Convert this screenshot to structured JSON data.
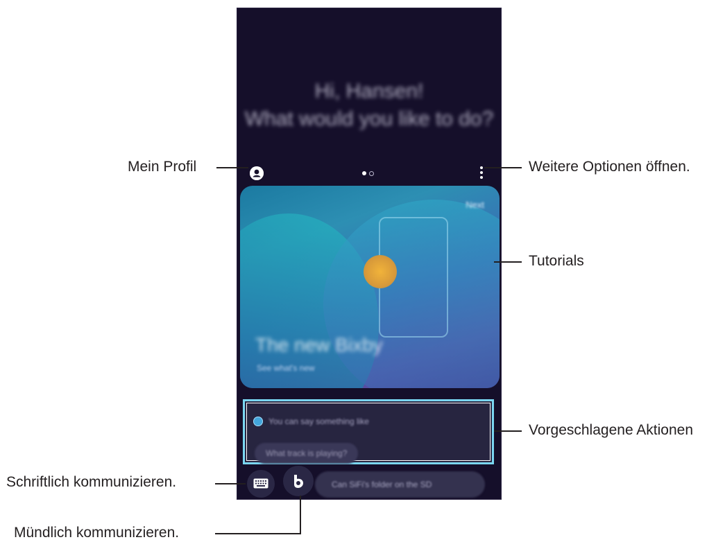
{
  "callouts": {
    "profile": "Mein Profil",
    "more_options": "Weitere Optionen öffnen.",
    "tutorials": "Tutorials",
    "suggested_actions": "Vorgeschlagene Aktionen",
    "write": "Schriftlich kommunizieren.",
    "speak": "Mündlich kommunizieren."
  },
  "screen": {
    "greeting_line1": "Hi, Hansen!",
    "greeting_line2": "What would you like to do?",
    "tutorial_card": {
      "next_label": "Next",
      "title": "The new Bixby",
      "subtitle": "See what's new"
    },
    "suggestions": {
      "intro": "You can say something like",
      "chip": "What track is playing?"
    },
    "input_hint": "Can SiFi's folder on the SD",
    "page_indicator": {
      "active": 1,
      "count": 2
    }
  },
  "icons": {
    "profile": "profile-icon",
    "more": "more-vertical-icon",
    "keyboard": "keyboard-icon",
    "bixby": "bixby-icon",
    "suggest": "bixby-suggest-icon"
  },
  "colors": {
    "screen_bg": "#150f2a",
    "highlight_border": "#7ad6f0",
    "callout_text": "#231f20"
  }
}
